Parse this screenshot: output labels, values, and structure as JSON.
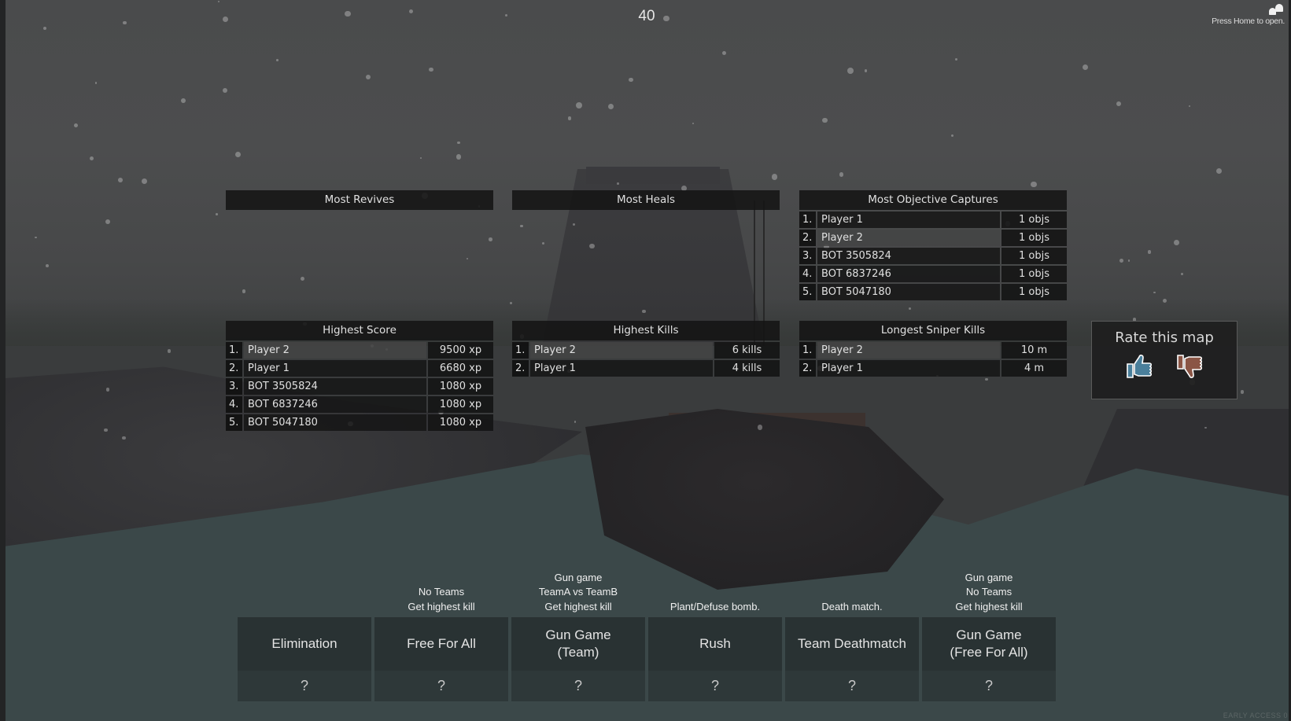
{
  "hud": {
    "round_timer": "40",
    "social_hint": "Press Home to open.",
    "social_icon": "friends-icon",
    "watermark": "EARLY ACCESS 0"
  },
  "panels": {
    "most_revives": {
      "title": "Most Revives",
      "rows": []
    },
    "most_heals": {
      "title": "Most Heals",
      "rows": []
    },
    "most_objective_captures": {
      "title": "Most Objective Captures",
      "rows": [
        {
          "rank": "1.",
          "name": "Player 1",
          "value": "1 objs"
        },
        {
          "rank": "2.",
          "name": "Player 2",
          "value": "1 objs"
        },
        {
          "rank": "3.",
          "name": "BOT 3505824",
          "value": "1 objs"
        },
        {
          "rank": "4.",
          "name": "BOT 6837246",
          "value": "1 objs"
        },
        {
          "rank": "5.",
          "name": "BOT 5047180",
          "value": "1 objs"
        }
      ]
    },
    "highest_score": {
      "title": "Highest Score",
      "rows": [
        {
          "rank": "1.",
          "name": "Player 2",
          "value": "9500 xp"
        },
        {
          "rank": "2.",
          "name": "Player 1",
          "value": "6680 xp"
        },
        {
          "rank": "3.",
          "name": "BOT 3505824",
          "value": "1080 xp"
        },
        {
          "rank": "4.",
          "name": "BOT 6837246",
          "value": "1080 xp"
        },
        {
          "rank": "5.",
          "name": "BOT 5047180",
          "value": "1080 xp"
        }
      ]
    },
    "highest_kills": {
      "title": "Highest Kills",
      "rows": [
        {
          "rank": "1.",
          "name": "Player 2",
          "value": "6 kills"
        },
        {
          "rank": "2.",
          "name": "Player 1",
          "value": "4 kills"
        }
      ]
    },
    "longest_sniper_kills": {
      "title": "Longest Sniper Kills",
      "rows": [
        {
          "rank": "1.",
          "name": "Player 2",
          "value": "10 m"
        },
        {
          "rank": "2.",
          "name": "Player 1",
          "value": "4 m"
        }
      ]
    }
  },
  "rate_map": {
    "title": "Rate this map",
    "like_icon": "thumbs-up-icon",
    "dislike_icon": "thumbs-down-icon",
    "like_color": "#4a7f9b",
    "dislike_color": "#8a5545"
  },
  "modes": [
    {
      "name": "Elimination",
      "description": [],
      "votes": "?"
    },
    {
      "name": "Free For All",
      "description": [
        "No Teams",
        "Get highest kill"
      ],
      "votes": "?"
    },
    {
      "name": "Gun Game\n(Team)",
      "description": [
        "Gun game",
        "TeamA vs TeamB",
        "Get highest kill"
      ],
      "votes": "?"
    },
    {
      "name": "Rush",
      "description": [
        "Plant/Defuse bomb."
      ],
      "votes": "?"
    },
    {
      "name": "Team Deathmatch",
      "description": [
        "Death match."
      ],
      "votes": "?"
    },
    {
      "name": "Gun Game\n(Free For All)",
      "description": [
        "Gun game",
        "No Teams",
        "Get highest kill"
      ],
      "votes": "?"
    }
  ]
}
